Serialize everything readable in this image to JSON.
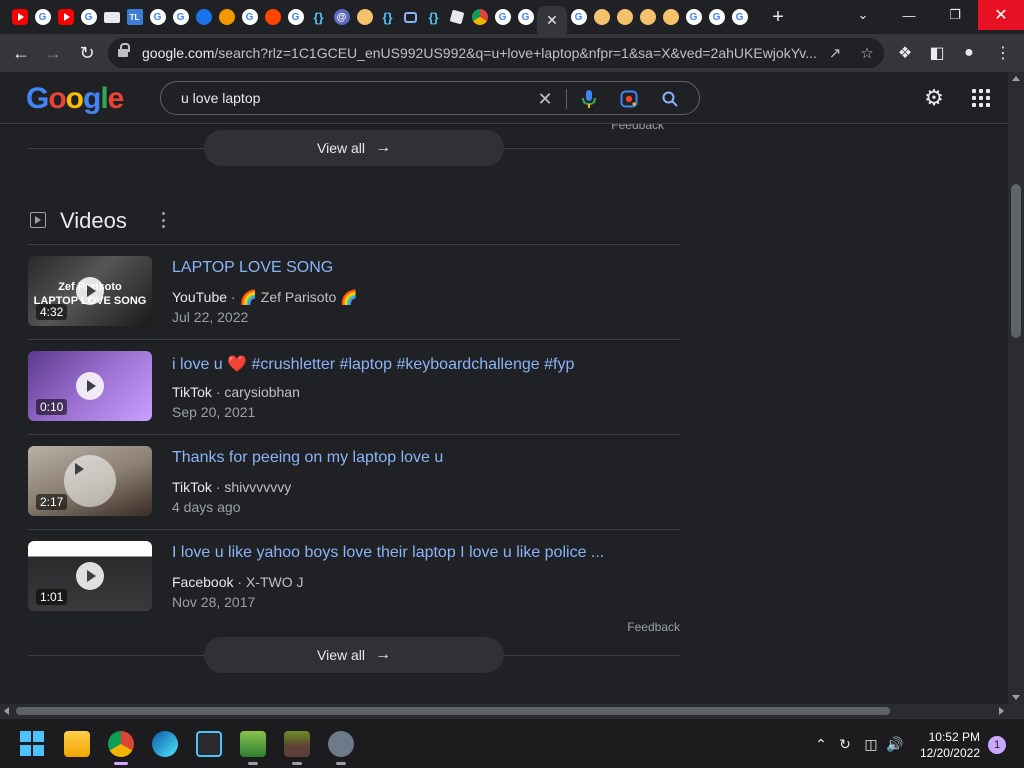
{
  "browser": {
    "url_host": "google.com",
    "url_rest": "/search?rlz=1C1GCEU_enUS992US992&q=u+love+laptop&nfpr=1&sa=X&ved=2ahUKEwjokYv...",
    "tab_favicons": [
      "youtube",
      "google",
      "youtube",
      "google",
      "monitor",
      "tl",
      "google",
      "google",
      "wave",
      "orange",
      "google",
      "reddit",
      "google",
      "brace",
      "at",
      "shell",
      "brace",
      "chat",
      "brace",
      "roblox",
      "chrome",
      "google",
      "google"
    ],
    "tabs_after_active": [
      "google",
      "shell",
      "shell",
      "shell",
      "shell",
      "google",
      "google",
      "google"
    ],
    "tl_label": "TL"
  },
  "search": {
    "query": "u love laptop"
  },
  "videos_section": {
    "title": "Videos",
    "view_all_label": "View all",
    "feedback_label": "Feedback",
    "items": [
      {
        "title": "LAPTOP LOVE SONG",
        "site": "YouTube",
        "author": "🌈 Zef Parisoto 🌈",
        "date": "Jul 22, 2022",
        "duration": "4:32",
        "thumb_text": "Zef Parisoto\nLAPTOP LOVE SONG"
      },
      {
        "title": "i love u ❤️ #crushletter #laptop #keyboardchallenge #fyp",
        "site": "TikTok",
        "author": "carysiobhan",
        "date": "Sep 20, 2021",
        "duration": "0:10"
      },
      {
        "title": "Thanks for peeing on my laptop love u",
        "site": "TikTok",
        "author": "shivvvvvvy",
        "date": "4 days ago",
        "duration": "2:17"
      },
      {
        "title": "I love u like yahoo boys love their laptop I love u like police ...",
        "site": "Facebook",
        "author": "X-TWO J",
        "date": "Nov 28, 2017",
        "duration": "1:01"
      }
    ]
  },
  "top": {
    "view_all_label": "View all",
    "feedback_label": "Feedback"
  },
  "taskbar": {
    "time": "10:52 PM",
    "date": "12/20/2022",
    "notification_count": "1"
  }
}
